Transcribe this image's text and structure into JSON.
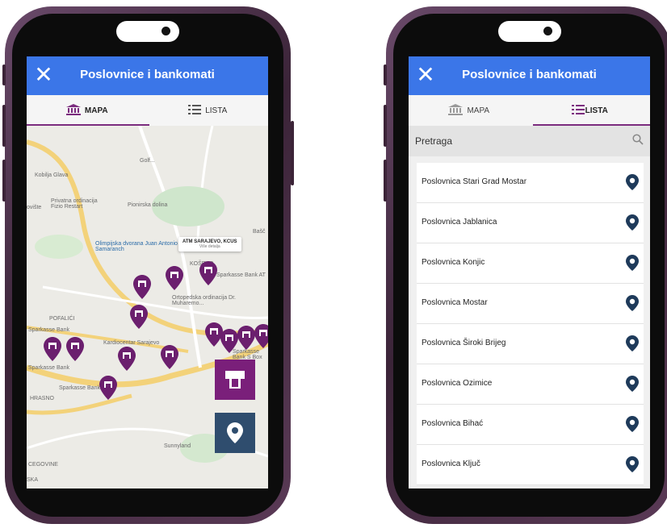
{
  "app": {
    "title": "Poslovnice i bankomati",
    "close_icon": "close-icon"
  },
  "tabs": {
    "map": "MAPA",
    "list": "LISTA"
  },
  "colors": {
    "appbar": "#3b76e8",
    "accent": "#7b2c7e",
    "pin": "#6b1f6e",
    "fab_atm": "#7a1f7a",
    "fab_location": "#2f4d6e",
    "list_pin": "#1e3a5a"
  },
  "map": {
    "labels": [
      "Kobilja Glava",
      "Privatna ordinacija Fizio Restart",
      "Pionirska dolina",
      "Olimpijska dvorana Juan Antonio Samaranch",
      "KOŠEVO",
      "Sparkasse Bank AT",
      "POFALIĆI",
      "Sparkasse Bank",
      "Sparkasse Bank",
      "Ortopedska ordinacija Dr. Muharemo...",
      "Kardiocentar Sarajevo",
      "Sparkasse Bank S Box",
      "Sparkasse Bank",
      "HRASNO",
      "Sunnyland",
      "Golf...",
      "CEGOVINE",
      "ovište",
      "Bašč",
      "SKA"
    ],
    "popup": {
      "title": "ATM SARAJEVO, KCUS",
      "subtitle": "Više detalja"
    }
  },
  "search": {
    "placeholder": "Pretraga"
  },
  "branches": [
    "Poslovnica Stari Grad Mostar",
    "Poslovnica Jablanica",
    "Poslovnica Konjic",
    "Poslovnica Mostar",
    "Poslovnica Široki Brijeg",
    "Poslovnica Ozimice",
    "Poslovnica Bihać",
    "Poslovnica Ključ"
  ]
}
